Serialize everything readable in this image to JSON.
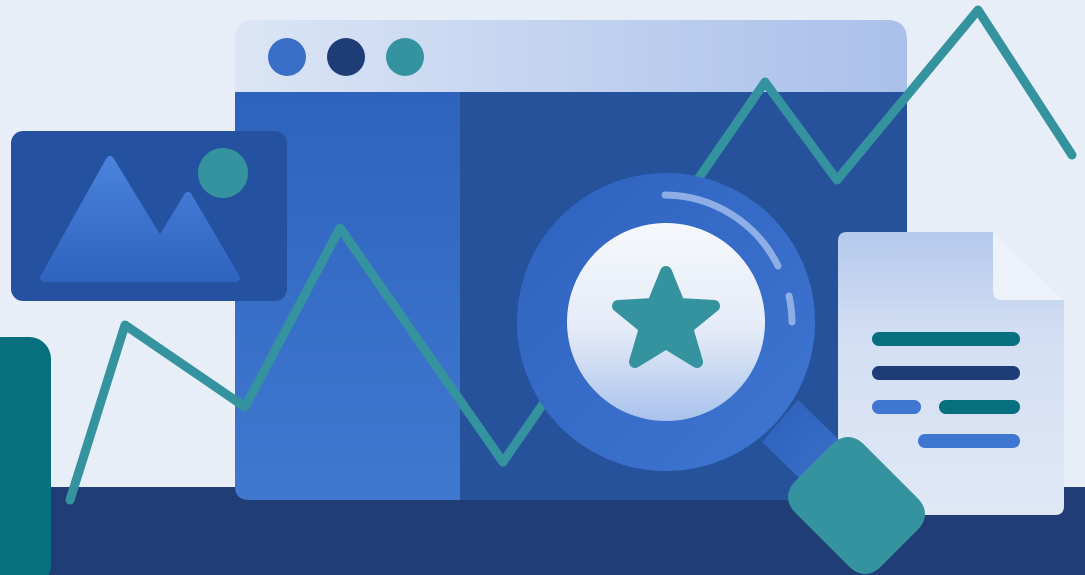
{
  "colors": {
    "background": "#e8eef8",
    "floor": "#203d76",
    "window_titlebar_start": "#d7e2f4",
    "window_titlebar_end": "#aec3ea",
    "window_left_panel": "#3a6fc8",
    "window_right_panel": "#25529b",
    "dot_1": "#3a6fc8",
    "dot_2": "#1e3d76",
    "dot_3": "#3593a0",
    "teal": "#3593a0",
    "dark_teal": "#06707f",
    "image_card": "#2552a0",
    "mountain": "#3f76d0",
    "magnifier_ring": "#3a6cc8",
    "magnifier_lens": "#f2f5fb",
    "document": "#d7e2f4",
    "doc_line_teal": "#06707f",
    "doc_line_navy": "#1e3d76",
    "doc_line_blue": "#3f76d0"
  },
  "icons": {
    "window": "browser-window-icon",
    "image": "image-placeholder-icon",
    "magnifier": "magnifying-glass-icon",
    "star": "star-icon",
    "document": "document-icon",
    "trend": "trend-line-icon"
  }
}
